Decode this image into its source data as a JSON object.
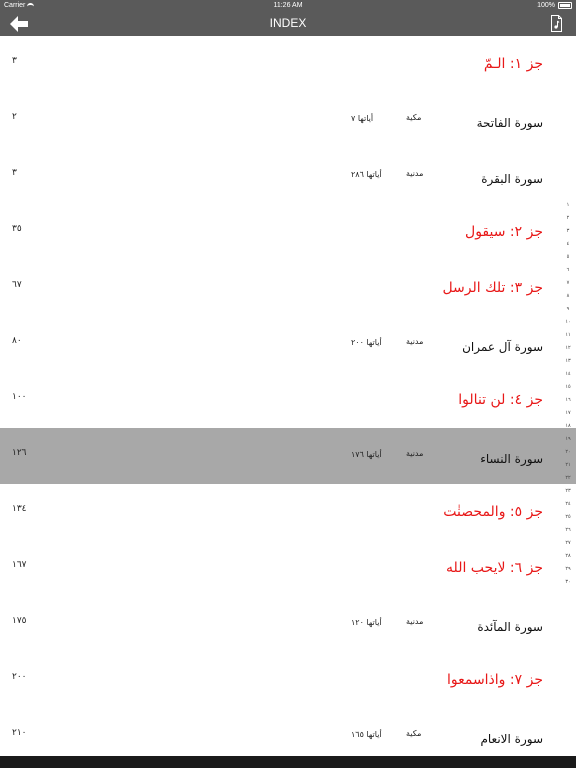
{
  "status": {
    "carrier": "Carrier",
    "time": "11:26 AM",
    "battery": "100%"
  },
  "nav": {
    "title": "INDEX"
  },
  "rows": [
    {
      "kind": "juz",
      "title": "جز ١: الـمّ",
      "page": "٣"
    },
    {
      "kind": "surah",
      "title": "سورة الفاتحة",
      "place": "مكية",
      "ayat": "أياتها ٧",
      "page": "٢"
    },
    {
      "kind": "surah",
      "title": "سورة البقرة",
      "place": "مدنية",
      "ayat": "أياتها ٢٨٦",
      "page": "٣"
    },
    {
      "kind": "juz",
      "title": "جز ٢: سيقول",
      "page": "٣٥"
    },
    {
      "kind": "juz",
      "title": "جز ٣: تلك الرسل",
      "page": "٦٧"
    },
    {
      "kind": "surah",
      "title": "سورة آل عمران",
      "place": "مدنية",
      "ayat": "أياتها ٢٠٠",
      "page": "٨٠"
    },
    {
      "kind": "juz",
      "title": "جز ٤: لن تنالوا",
      "page": "١٠٠"
    },
    {
      "kind": "surah",
      "title": "سورة النساء",
      "place": "مدنية",
      "ayat": "أياتها ١٧٦",
      "page": "١٢٦",
      "selected": true
    },
    {
      "kind": "juz",
      "title": "جز ٥: والمحصنٰت",
      "page": "١٣٤"
    },
    {
      "kind": "juz",
      "title": "جز ٦: لايحب الله",
      "page": "١٦٧"
    },
    {
      "kind": "surah",
      "title": "سورة المآئدة",
      "place": "مدنية",
      "ayat": "أياتها ١٢٠",
      "page": "١٧٥"
    },
    {
      "kind": "juz",
      "title": "جز ٧: واذاسمعوا",
      "page": "٢٠٠"
    },
    {
      "kind": "surah",
      "title": "سورة الانعام",
      "place": "مكية",
      "ayat": "أياتها ١٦٥",
      "page": "٢١٠"
    }
  ],
  "index": [
    "١",
    "٢",
    "٣",
    "٤",
    "٥",
    "٦",
    "٧",
    "٨",
    "٩",
    "١٠",
    "١١",
    "١٢",
    "١٣",
    "١٤",
    "١٥",
    "١٦",
    "١٧",
    "١٨",
    "١٩",
    "٢٠",
    "٢١",
    "٢٢",
    "٢٣",
    "٢٤",
    "٢٥",
    "٢٦",
    "٢٧",
    "٢٨",
    "٢٩",
    "٣٠"
  ]
}
